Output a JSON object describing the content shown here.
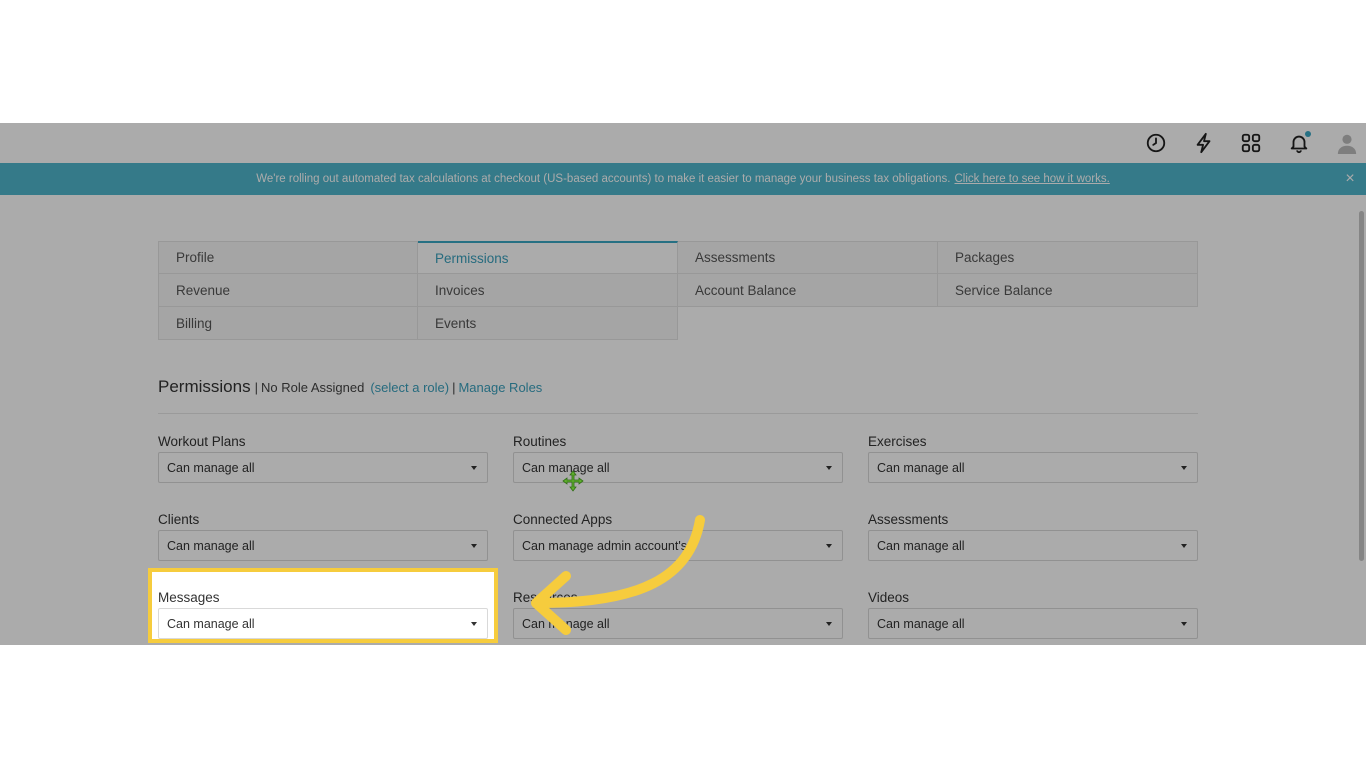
{
  "banner": {
    "message": "We're rolling out automated tax calculations at checkout (US-based accounts) to make it easier to manage your business tax obligations.",
    "link": "Click here to see how it works.",
    "close": "×"
  },
  "topbar_icons": [
    "clock-icon",
    "lightning-icon",
    "apps-grid-icon",
    "bell-icon",
    "user-avatar-icon"
  ],
  "tabs": [
    {
      "label": "Profile"
    },
    {
      "label": "Permissions",
      "active": true
    },
    {
      "label": "Assessments"
    },
    {
      "label": "Packages"
    },
    {
      "label": "Revenue"
    },
    {
      "label": "Invoices"
    },
    {
      "label": "Account Balance"
    },
    {
      "label": "Service Balance"
    },
    {
      "label": "Billing"
    },
    {
      "label": "Events"
    }
  ],
  "permissions": {
    "title": "Permissions",
    "separator": "|",
    "role_status": "No Role Assigned",
    "select_role": "(select a role)",
    "manage_roles": "Manage Roles",
    "fields": [
      {
        "label": "Workout Plans",
        "value": "Can manage all"
      },
      {
        "label": "Routines",
        "value": "Can manage all"
      },
      {
        "label": "Exercises",
        "value": "Can manage all"
      },
      {
        "label": "Clients",
        "value": "Can manage all"
      },
      {
        "label": "Connected Apps",
        "value": "Can manage admin account's"
      },
      {
        "label": "Assessments",
        "value": "Can manage all"
      },
      {
        "label": "Messages",
        "value": "Can manage all"
      },
      {
        "label": "Resources",
        "value": "Can manage all"
      },
      {
        "label": "Videos",
        "value": "Can manage all"
      }
    ]
  },
  "colors": {
    "banner": "#4fb6cc",
    "accent": "#3aa0bd",
    "highlight": "#f6cc3d",
    "arrow": "#f6cc3d"
  }
}
